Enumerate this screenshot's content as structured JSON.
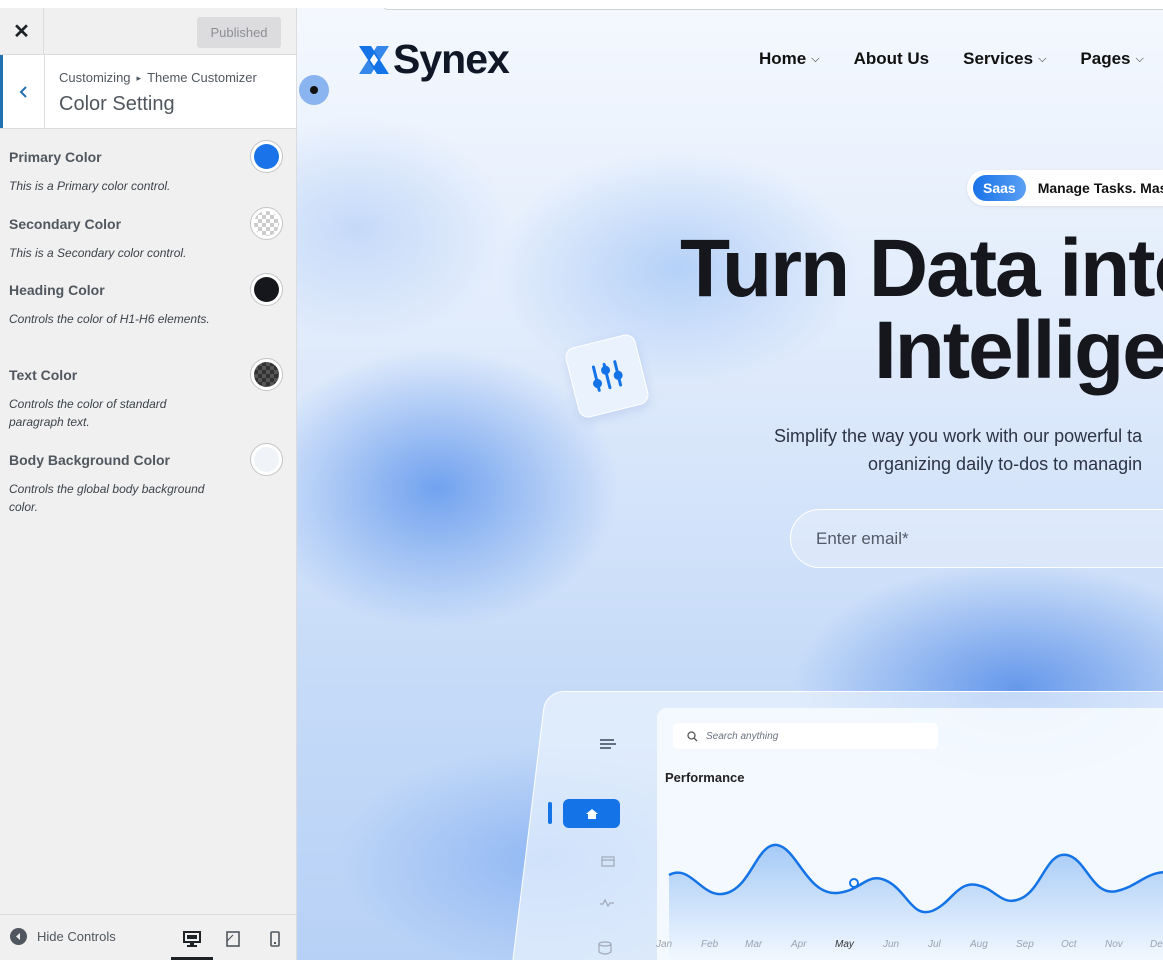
{
  "customizer": {
    "close_icon": "close-icon",
    "publish_label": "Published",
    "breadcrumb_root": "Customizing",
    "breadcrumb_current": "Theme Customizer",
    "section_title": "Color Setting",
    "controls": [
      {
        "label": "Primary Color",
        "description": "This is a Primary color control.",
        "color": "#1a73e8"
      },
      {
        "label": "Secondary Color",
        "description": "This is a Secondary color control.",
        "color": "transparent"
      },
      {
        "label": "Heading Color",
        "description": "Controls the color of H1-H6 elements.",
        "color": "#15171c"
      },
      {
        "label": "Text Color",
        "description": "Controls the color of standard paragraph text.",
        "color": "#333333"
      },
      {
        "label": "Body Background Color",
        "description": "Controls the global body background color.",
        "color": "#f0f4f8"
      }
    ],
    "hide_controls_label": "Hide Controls",
    "devices": [
      "desktop",
      "tablet",
      "mobile"
    ],
    "active_device": "desktop"
  },
  "site": {
    "logo_text": "Synex",
    "nav": [
      {
        "label": "Home",
        "dropdown": true
      },
      {
        "label": "About Us",
        "dropdown": false
      },
      {
        "label": "Services",
        "dropdown": true
      },
      {
        "label": "Pages",
        "dropdown": true
      }
    ],
    "badge_pill": "Saas",
    "badge_text": "Manage Tasks. Mas",
    "hero_title_line1": "Turn Data into",
    "hero_title_line2": "Intellige",
    "hero_sub_line1": "Simplify the way you work with our powerful ta",
    "hero_sub_line2": "organizing daily to-dos to managin",
    "email_placeholder": "Enter email*",
    "dashboard": {
      "search_placeholder": "Search anything",
      "performance_label": "Performance",
      "months": [
        "Jan",
        "Feb",
        "Mar",
        "Apr",
        "May",
        "Jun",
        "Jul",
        "Aug",
        "Sep",
        "Oct",
        "Nov",
        "De"
      ]
    }
  },
  "colors": {
    "accent": "#2271b1",
    "brand": "#1473e6"
  }
}
